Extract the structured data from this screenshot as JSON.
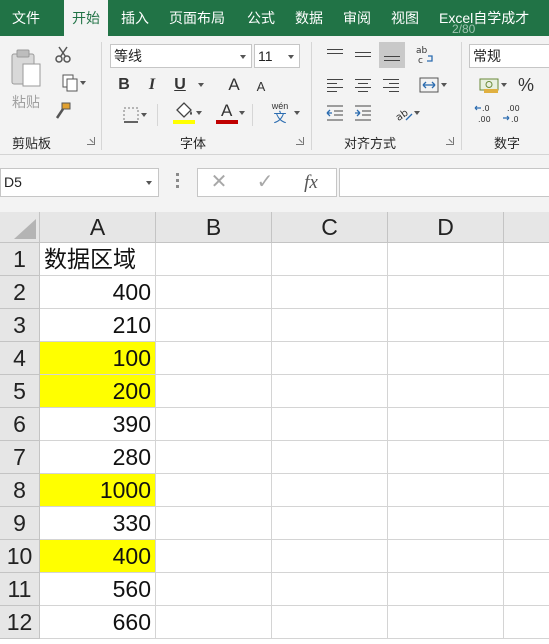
{
  "tabs": [
    {
      "label": "文件",
      "active": false
    },
    {
      "label": "开始",
      "active": true
    },
    {
      "label": "插入",
      "active": false
    },
    {
      "label": "页面布局",
      "active": false
    },
    {
      "label": "公式",
      "active": false
    },
    {
      "label": "数据",
      "active": false
    },
    {
      "label": "审阅",
      "active": false
    },
    {
      "label": "视图",
      "active": false
    },
    {
      "label": "Excel自学成才",
      "active": false
    }
  ],
  "watermark": "2/80",
  "ribbon": {
    "clipboard": {
      "paste_label": "粘贴",
      "group_label": "剪贴板"
    },
    "font": {
      "font_name": "等线",
      "font_size": "11",
      "bold": "B",
      "italic": "I",
      "underline": "U",
      "grow": "A",
      "shrink": "A",
      "color_letter": "A",
      "phonetic_top": "wén",
      "phonetic_bottom": "文",
      "group_label": "字体",
      "highlight_color": "#ffff00",
      "font_color": "#c00000"
    },
    "alignment": {
      "group_label": "对齐方式"
    },
    "number": {
      "format": "常规",
      "percent": "%",
      "group_label": "数字",
      "inc_decimal": "←.0\n.00",
      "dec_decimal": ".00\n→.0"
    }
  },
  "formula_bar": {
    "name_box": "D5",
    "cancel": "✕",
    "confirm": "✓",
    "fx": "fx",
    "formula": ""
  },
  "columns": [
    "A",
    "B",
    "C",
    "D"
  ],
  "rows": [
    {
      "num": "1",
      "a": "数据区域",
      "highlight": false,
      "text": true
    },
    {
      "num": "2",
      "a": "400",
      "highlight": false
    },
    {
      "num": "3",
      "a": "210",
      "highlight": false
    },
    {
      "num": "4",
      "a": "100",
      "highlight": true
    },
    {
      "num": "5",
      "a": "200",
      "highlight": true
    },
    {
      "num": "6",
      "a": "390",
      "highlight": false
    },
    {
      "num": "7",
      "a": "280",
      "highlight": false
    },
    {
      "num": "8",
      "a": "1000",
      "highlight": true
    },
    {
      "num": "9",
      "a": "330",
      "highlight": false
    },
    {
      "num": "10",
      "a": "400",
      "highlight": true
    },
    {
      "num": "11",
      "a": "560",
      "highlight": false
    },
    {
      "num": "12",
      "a": "660",
      "highlight": false
    }
  ],
  "colors": {
    "accent": "#217346",
    "highlight": "#ffff00"
  }
}
